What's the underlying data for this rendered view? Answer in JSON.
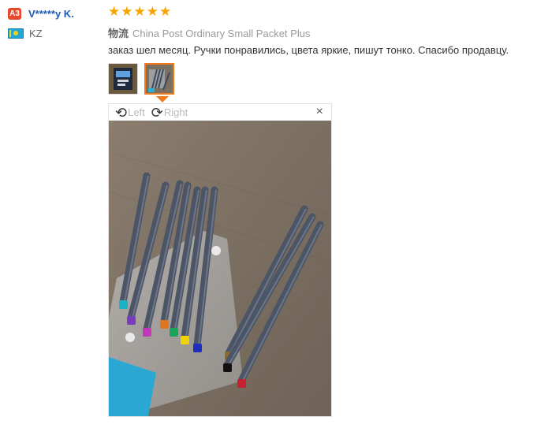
{
  "user": {
    "level": "A3",
    "name": "V*****y K.",
    "country": "KZ",
    "flag_icon": "kazakhstan-flag-icon"
  },
  "review": {
    "rating": 5,
    "max_rating": 5,
    "logistics_label": "物流",
    "logistics_value": "China Post Ordinary Small Packet Plus",
    "text": "заказ шел месяц. Ручки понравились, цвета яркие, пишут тонко. Спасибо продавцу."
  },
  "viewer": {
    "rotate_left_label": "Left",
    "rotate_right_label": "Right",
    "close_glyph": "×",
    "rotate_left_icon": "rotate-left-icon",
    "rotate_right_icon": "rotate-right-icon",
    "close_icon": "close-icon"
  },
  "colors": {
    "star": "#f7a500",
    "level_badge": "#e8482b",
    "username": "#1d5bb4",
    "active_thumb": "#f07b1d"
  },
  "pens": {
    "cap_colors": [
      "#19b3c9",
      "#7a3bbf",
      "#c038b5",
      "#e0761e",
      "#1aa35a",
      "#f0d400",
      "#1e2ec0",
      "#8a6a2a",
      "#111111",
      "#c7202f"
    ]
  }
}
